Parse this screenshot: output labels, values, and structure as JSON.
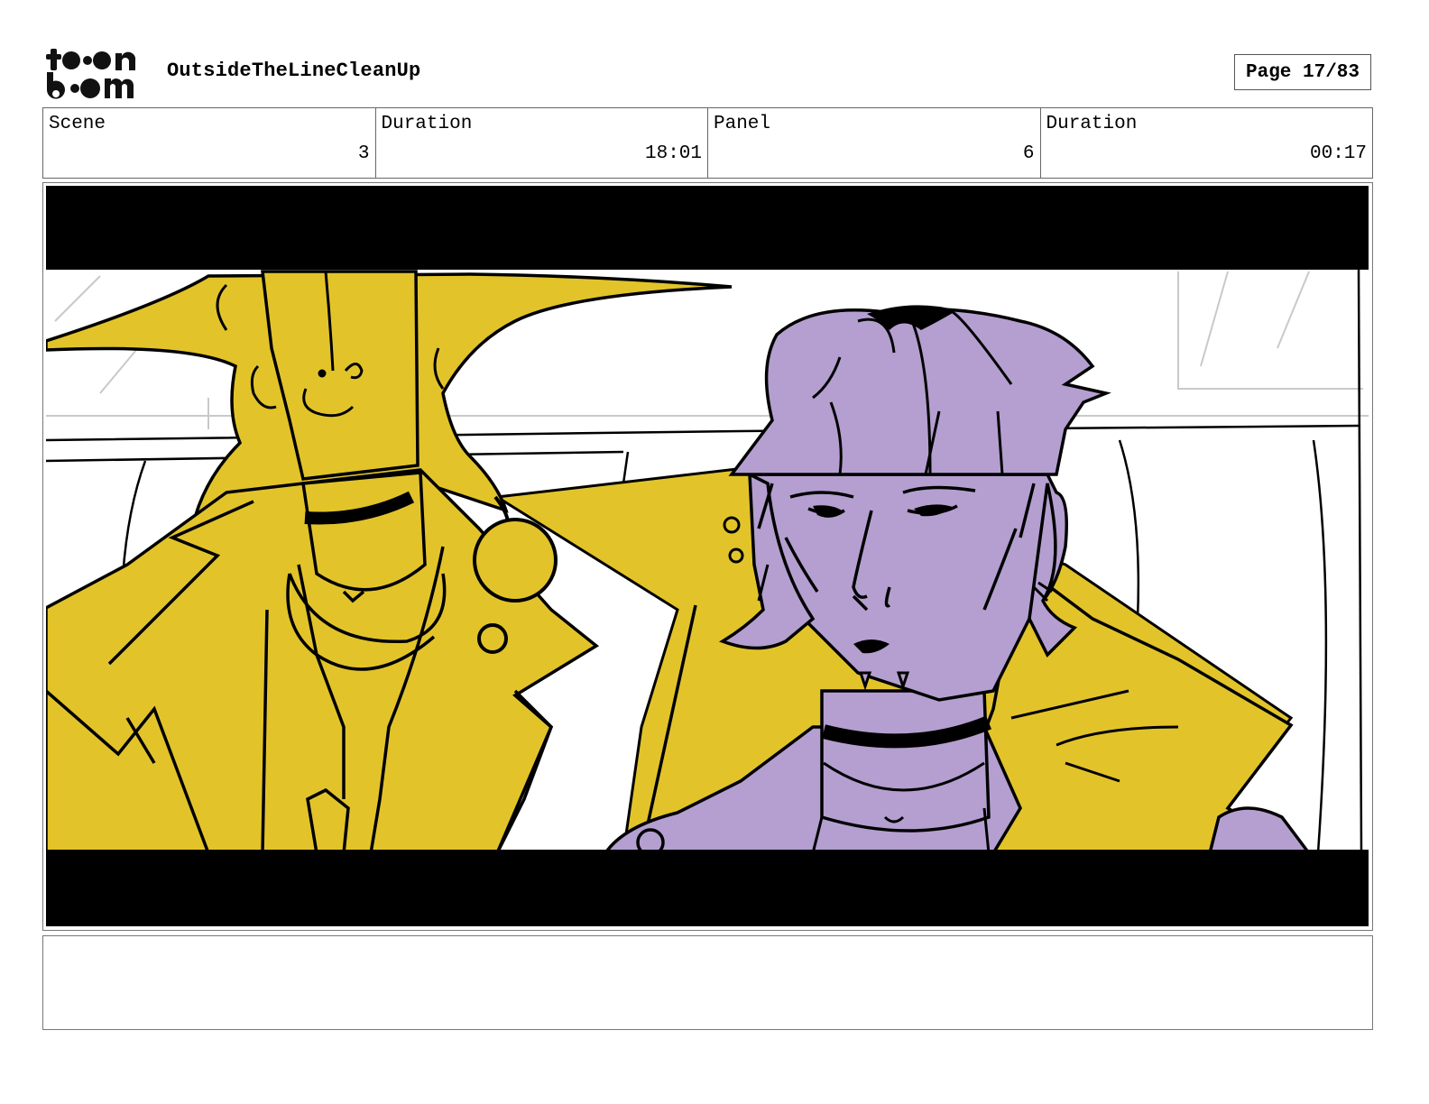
{
  "header": {
    "logo_text": "toon boom",
    "project_title": "OutsideTheLineCleanUp",
    "page_label": "Page 17/83"
  },
  "info": {
    "scene_label": "Scene",
    "scene_value": "3",
    "scene_duration_label": "Duration",
    "scene_duration_value": "18:01",
    "panel_label": "Panel",
    "panel_value": "6",
    "panel_duration_label": "Duration",
    "panel_duration_value": "00:17"
  },
  "panel": {
    "colors": {
      "yellow": "#e2c42a",
      "purple": "#b49fd0",
      "letterbox": "#000000",
      "background": "#ffffff"
    }
  },
  "caption": {
    "text": ""
  }
}
